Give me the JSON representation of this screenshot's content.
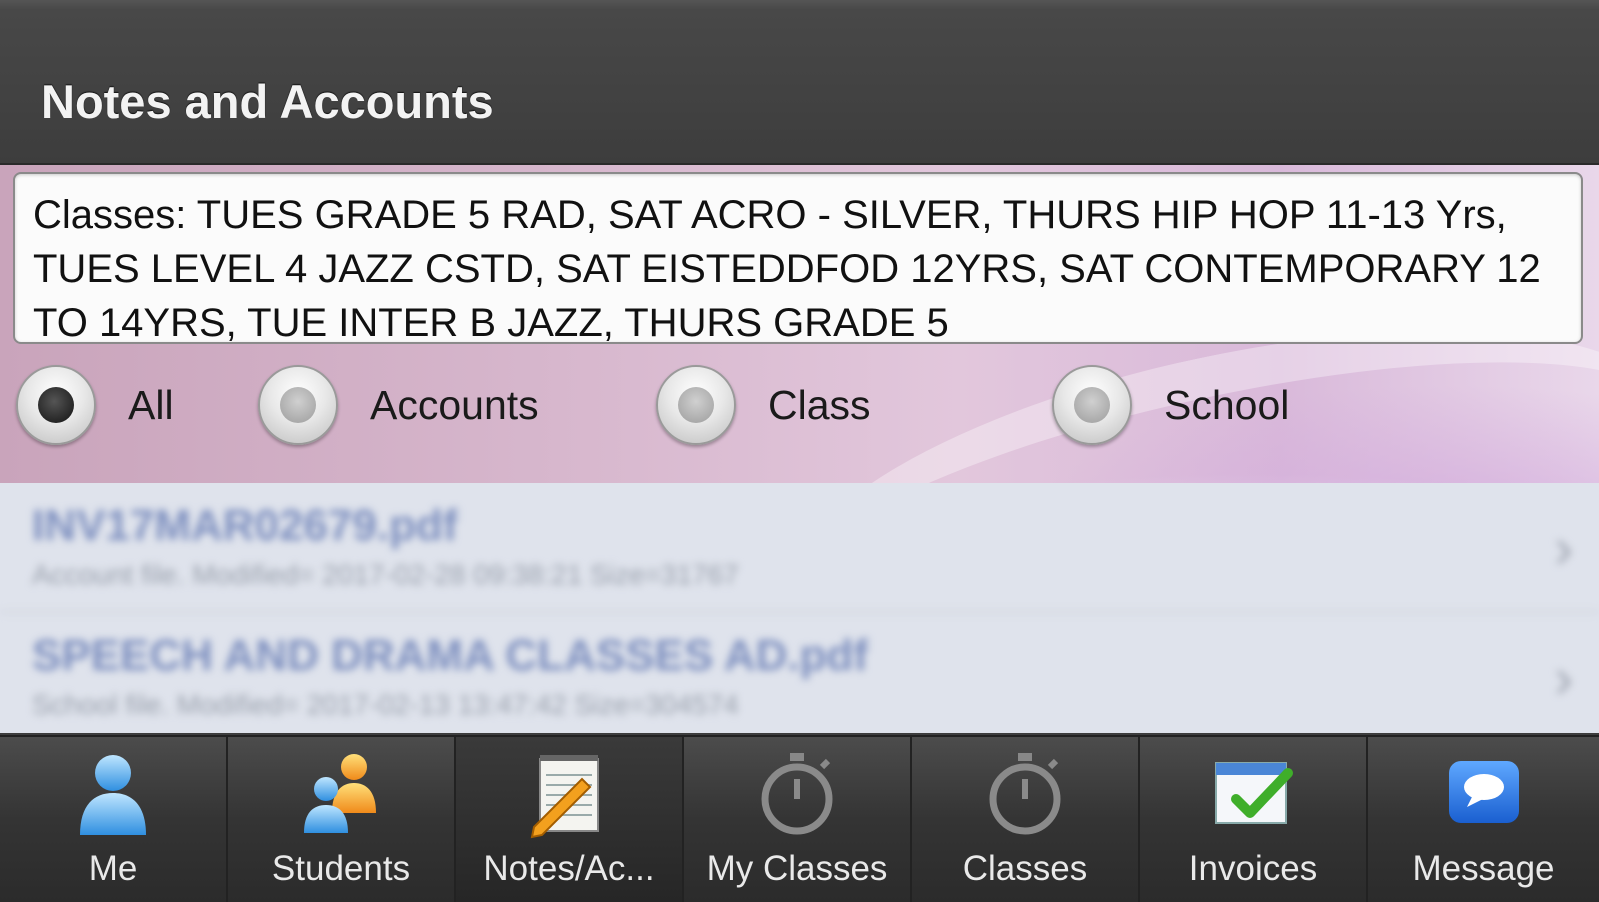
{
  "header": {
    "title": "Notes and Accounts"
  },
  "classes_text": "Classes: TUES GRADE 5 RAD, SAT ACRO - SILVER, THURS HIP HOP 11-13 Yrs, TUES LEVEL 4 JAZZ CSTD, SAT EISTEDDFOD 12YRS, SAT CONTEMPORARY 12 TO 14YRS, TUE INTER B JAZZ, THURS GRADE 5",
  "filters": [
    {
      "label": "All",
      "selected": true
    },
    {
      "label": "Accounts",
      "selected": false
    },
    {
      "label": "Class",
      "selected": false
    },
    {
      "label": "School",
      "selected": false
    }
  ],
  "list": [
    {
      "title": "INV17MAR02679.pdf",
      "subtitle": "Account file. Modified= 2017-02-28 09:38:21 Size=31767"
    },
    {
      "title": "SPEECH AND DRAMA CLASSES AD.pdf",
      "subtitle": "School file. Modified= 2017-02-13 13:47:42 Size=304574"
    }
  ],
  "tabs": [
    {
      "label": "Me",
      "icon": "person-icon",
      "active": false
    },
    {
      "label": "Students",
      "icon": "group-icon",
      "active": false
    },
    {
      "label": "Notes/Ac...",
      "icon": "notepad-pencil-icon",
      "active": true
    },
    {
      "label": "My Classes",
      "icon": "stopwatch-icon",
      "active": false
    },
    {
      "label": "Classes",
      "icon": "stopwatch-icon",
      "active": false
    },
    {
      "label": "Invoices",
      "icon": "invoice-check-icon",
      "active": false
    },
    {
      "label": "Message",
      "icon": "speech-bubble-icon",
      "active": false
    }
  ],
  "colors": {
    "header_bg": "#3d3d3d",
    "banner_pink": "#d7b7cd",
    "list_bg": "#dfe3ec",
    "tabbar_bg": "#343434"
  }
}
